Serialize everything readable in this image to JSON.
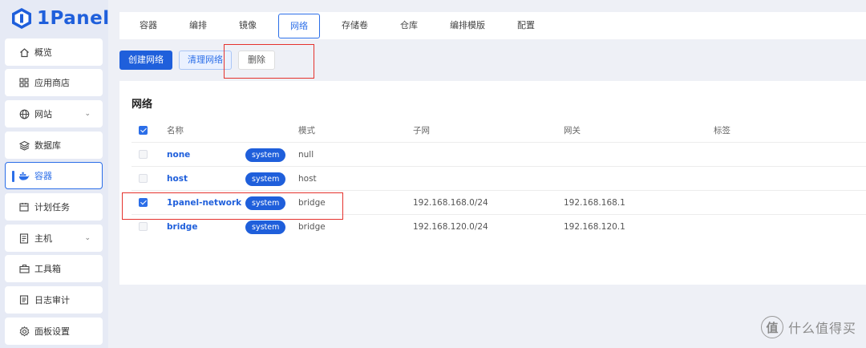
{
  "app": {
    "logo_text": "1Panel"
  },
  "sidebar": {
    "items": [
      {
        "label": "概览",
        "icon": "home-icon"
      },
      {
        "label": "应用商店",
        "icon": "grid-icon"
      },
      {
        "label": "网站",
        "icon": "globe-icon",
        "expandable": true
      },
      {
        "label": "数据库",
        "icon": "layers-icon"
      },
      {
        "label": "容器",
        "icon": "docker-icon",
        "active": true
      },
      {
        "label": "计划任务",
        "icon": "calendar-icon"
      },
      {
        "label": "主机",
        "icon": "server-icon",
        "expandable": true
      },
      {
        "label": "工具箱",
        "icon": "toolbox-icon"
      },
      {
        "label": "日志审计",
        "icon": "log-icon"
      },
      {
        "label": "面板设置",
        "icon": "gear-icon"
      }
    ]
  },
  "tabs": [
    "容器",
    "编排",
    "镜像",
    "网络",
    "存储卷",
    "仓库",
    "编排模版",
    "配置"
  ],
  "active_tab": "网络",
  "toolbar": {
    "create_label": "创建网络",
    "prune_label": "清理网络",
    "delete_label": "删除"
  },
  "panel": {
    "title": "网络"
  },
  "table": {
    "headers": {
      "name": "名称",
      "mode": "模式",
      "subnet": "子网",
      "gateway": "网关",
      "labels": "标签"
    },
    "rows": [
      {
        "name": "none",
        "tag": "system",
        "mode": "null",
        "subnet": "",
        "gateway": "",
        "checked": false
      },
      {
        "name": "host",
        "tag": "system",
        "mode": "host",
        "subnet": "",
        "gateway": "",
        "checked": false
      },
      {
        "name": "1panel-network",
        "tag": "system",
        "mode": "bridge",
        "subnet": "192.168.168.0/24",
        "gateway": "192.168.168.1",
        "checked": true
      },
      {
        "name": "bridge",
        "tag": "system",
        "mode": "bridge",
        "subnet": "192.168.120.0/24",
        "gateway": "192.168.120.1",
        "checked": false
      }
    ]
  },
  "watermark": {
    "text": "什么值得买",
    "symbol": "值"
  },
  "colors": {
    "primary": "#1f5fdb",
    "highlight": "#e5322d",
    "sidebar_bg": "#e6eaf5"
  }
}
